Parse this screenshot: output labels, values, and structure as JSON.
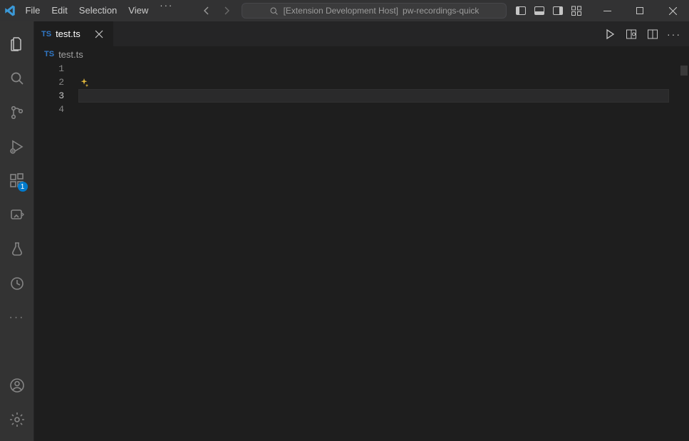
{
  "menubar": {
    "items": [
      "File",
      "Edit",
      "Selection",
      "View"
    ],
    "ellipsis": "···"
  },
  "command_center": {
    "prefix": "[Extension Development Host]",
    "project": "pw-recordings-quick"
  },
  "activitybar": {
    "badge_extensions": "1",
    "more": "···"
  },
  "tabs": [
    {
      "lang": "TS",
      "name": "test.ts"
    }
  ],
  "breadcrumb": {
    "lang": "TS",
    "name": "test.ts"
  },
  "editor": {
    "line_numbers": [
      "1",
      "2",
      "3",
      "4"
    ]
  }
}
